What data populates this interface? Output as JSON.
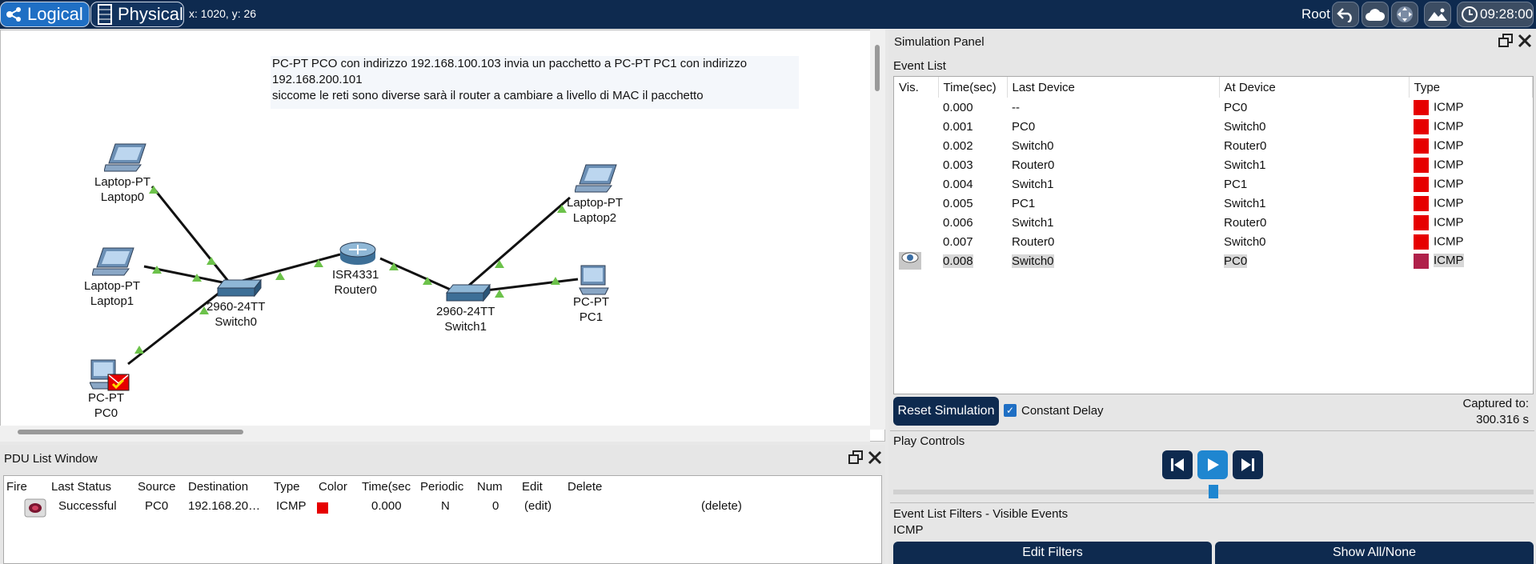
{
  "topbar": {
    "logical_label": "Logical",
    "physical_label": "Physical",
    "coords": "x: 1020, y: 26",
    "root_label": "Root",
    "time": "09:28:00",
    "icons": [
      "back-arrow-icon",
      "cloud-icon",
      "move-icon",
      "landscape-icon",
      "clock-globe-icon"
    ]
  },
  "workspace": {
    "note_lines": [
      "PC-PT PCO con indirizzo 192.168.100.103 invia un pacchetto a PC-PT PC1 con indirizzo",
      "192.168.200.101",
      "siccome le reti sono diverse sarà il router a cambiare a livello di MAC il pacchetto"
    ],
    "devices": [
      {
        "model": "Laptop-PT",
        "name": "Laptop0"
      },
      {
        "model": "Laptop-PT",
        "name": "Laptop1"
      },
      {
        "model": "2960-24TT",
        "name": "Switch0"
      },
      {
        "model": "PC-PT",
        "name": "PC0"
      },
      {
        "model": "ISR4331",
        "name": "Router0"
      },
      {
        "model": "2960-24TT",
        "name": "Switch1"
      },
      {
        "model": "Laptop-PT",
        "name": "Laptop2"
      },
      {
        "model": "PC-PT",
        "name": "PC1"
      }
    ]
  },
  "sim": {
    "title": "Simulation Panel",
    "event_list_label": "Event List",
    "columns": [
      "Vis.",
      "Time(sec)",
      "Last Device",
      "At Device",
      "Type"
    ],
    "events": [
      {
        "time": "0.000",
        "last": "--",
        "at": "PC0",
        "type": "ICMP"
      },
      {
        "time": "0.001",
        "last": "PC0",
        "at": "Switch0",
        "type": "ICMP"
      },
      {
        "time": "0.002",
        "last": "Switch0",
        "at": "Router0",
        "type": "ICMP"
      },
      {
        "time": "0.003",
        "last": "Router0",
        "at": "Switch1",
        "type": "ICMP"
      },
      {
        "time": "0.004",
        "last": "Switch1",
        "at": "PC1",
        "type": "ICMP"
      },
      {
        "time": "0.005",
        "last": "PC1",
        "at": "Switch1",
        "type": "ICMP"
      },
      {
        "time": "0.006",
        "last": "Switch1",
        "at": "Router0",
        "type": "ICMP"
      },
      {
        "time": "0.007",
        "last": "Router0",
        "at": "Switch0",
        "type": "ICMP"
      },
      {
        "time": "0.008",
        "last": "Switch0",
        "at": "PC0",
        "type": "ICMP"
      }
    ],
    "reset_label": "Reset Simulation",
    "constant_delay_label": "Constant Delay",
    "captured_label": "Captured to:",
    "captured_value": "300.316 s",
    "play_controls_label": "Play Controls",
    "filters_label": "Event List Filters - Visible Events",
    "filters_value": "ICMP",
    "edit_filters_label": "Edit Filters",
    "show_all_label": "Show All/None",
    "type_color": "#e60000"
  },
  "pdu": {
    "title": "PDU List Window",
    "columns": [
      "Fire",
      "Last Status",
      "Source",
      "Destination",
      "Type",
      "Color",
      "Time(sec",
      "Periodic",
      "Num",
      "Edit",
      "Delete"
    ],
    "row": {
      "status": "Successful",
      "source": "PC0",
      "destination": "192.168.20…",
      "type": "ICMP",
      "time": "0.000",
      "periodic": "N",
      "num": "0",
      "edit": "(edit)",
      "delete": "(delete)"
    }
  }
}
